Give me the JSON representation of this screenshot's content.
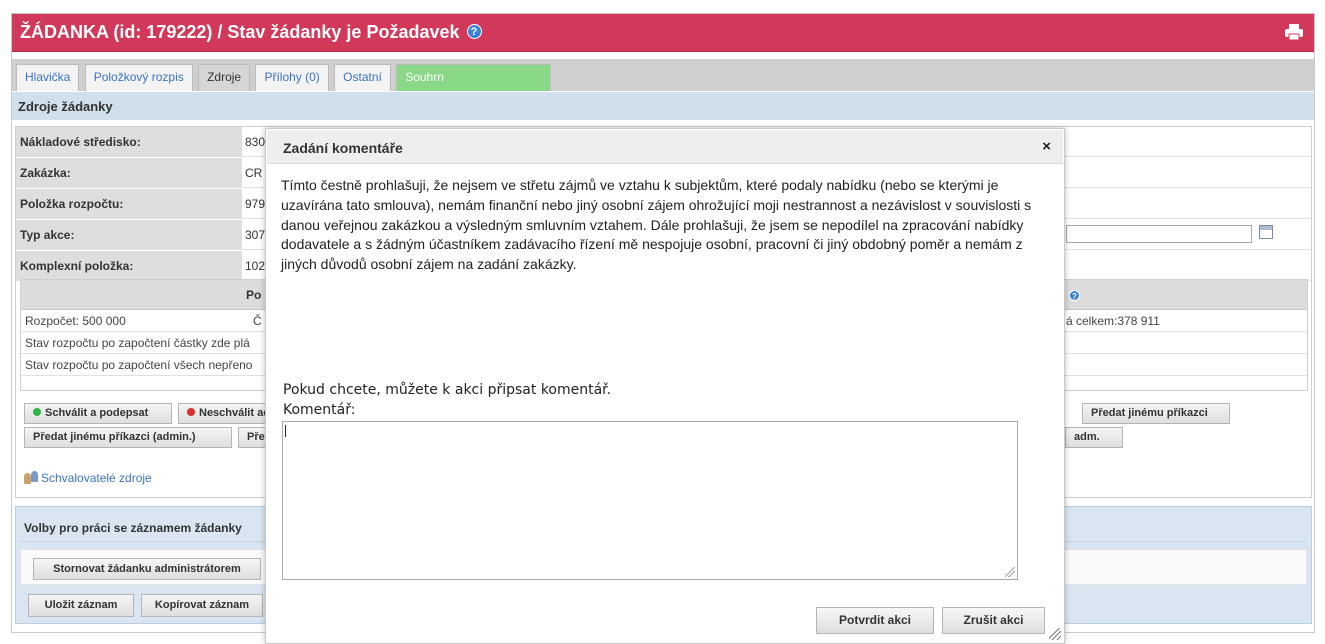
{
  "header": {
    "title": "ŽÁDANKA (id: 179222) / Stav žádanky je Požadavek",
    "info_glyph": "?",
    "print_icon": "printer-icon",
    "accent_color": "#d2385a"
  },
  "tabs": [
    {
      "label": "Hlavička"
    },
    {
      "label": "Položkový rozpis"
    },
    {
      "label": "Zdroje",
      "active": true
    },
    {
      "label": "Přílohy (0)"
    },
    {
      "label": "Ostatní"
    },
    {
      "label": "Souhrn"
    }
  ],
  "section_title": "Zdroje žádanky",
  "fields": [
    {
      "label": "Nákladové středisko:",
      "value": "830"
    },
    {
      "label": "Zakázka:",
      "value": "CR"
    },
    {
      "label": "Položka rozpočtu:",
      "value": "979"
    },
    {
      "label": "Typ akce:",
      "value": "307"
    },
    {
      "label": "Komplexní položka:",
      "value": "102"
    }
  ],
  "budget": {
    "header_left": "Po",
    "header_right_glyph": "?",
    "rows": [
      {
        "left": "Rozpočet: 500 000",
        "mid": "Č",
        "right": "á celkem:378 911"
      },
      {
        "left": "Stav rozpočtu po započtení částky zde plá",
        "mid": "",
        "right": ""
      },
      {
        "left": "Stav rozpočtu po započtení všech nepřeno",
        "mid": "",
        "right": ""
      }
    ]
  },
  "actions": {
    "approve_sign": "Schválit a podepsat",
    "disapprove": "Neschválit ac",
    "forward_other": "Předat jinému příkazci",
    "forward_other_admin": "Předat jinému příkazci (admin.)",
    "forward_partial": "Pře",
    "adm": "adm."
  },
  "approvers_link": "Schvalovatelé zdroje",
  "record_options": {
    "title": "Volby pro práci se záznamem žádanky",
    "cancel_admin": "Stornovat žádanku administrátorem",
    "save": "Uložit záznam",
    "copy": "Kopírovat záznam"
  },
  "dialog": {
    "title": "Zadání komentáře",
    "close_glyph": "×",
    "declaration": "Tímto čestně prohlašuji, že nejsem ve střetu zájmů ve vztahu k subjektům, které podaly nabídku (nebo se kterými je uzavírána tato smlouva), nemám finanční nebo jiný osobní zájem ohrožující moji nestrannost a nezávislost v souvislosti s danou veřejnou zakázkou a výsledným smluvním vztahem. Dále prohlašuji, že jsem se nepodílel na zpracování nabídky dodavatele a s žádným účastníkem zadávacího řízení mě nespojuje osobní, pracovní či jiný obdobný poměr a nemám z jiných důvodů osobní zájem na zadání zakázky.",
    "prompt": "Pokud chcete, můžete k akci připsat komentář.",
    "comment_label": "Komentář:",
    "comment_value": "",
    "confirm": "Potvrdit akci",
    "cancel": "Zrušit akci"
  }
}
